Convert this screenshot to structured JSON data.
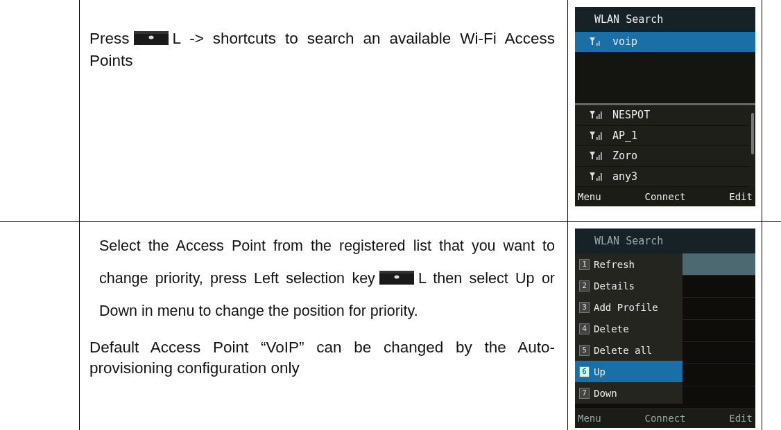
{
  "rows": [
    {
      "kind": "search",
      "text_before": "Press",
      "text_after": "L -> shortcuts to search an available Wi-Fi Access Points",
      "note": "",
      "phone": {
        "title": "WLAN Search",
        "selected_item": {
          "label": "voip",
          "selected": true
        },
        "items": [
          {
            "label": "NESPOT",
            "selected": false
          },
          {
            "label": "AP_1",
            "selected": false
          },
          {
            "label": "Zoro",
            "selected": false
          },
          {
            "label": "any3",
            "selected": false
          }
        ],
        "softkeys": [
          "Menu",
          "Connect",
          "Edit"
        ]
      }
    },
    {
      "kind": "menu",
      "text_before": "Select the Access Point from the registered list that you want to change priority, press Left selection key",
      "text_after": "L then select Up or Down in menu to change the position for priority.",
      "note": "Default Access Point “VoIP” can be changed by the Auto- provisioning configuration only",
      "phone": {
        "title": "WLAN Search",
        "menu": [
          {
            "number": "1",
            "label": "Refresh",
            "selected": false
          },
          {
            "number": "2",
            "label": "Details",
            "selected": false
          },
          {
            "number": "3",
            "label": "Add Profile",
            "selected": false
          },
          {
            "number": "4",
            "label": "Delete",
            "selected": false
          },
          {
            "number": "5",
            "label": "Delete all",
            "selected": false
          },
          {
            "number": "6",
            "label": "Up",
            "selected": true
          },
          {
            "number": "7",
            "label": "Down",
            "selected": false
          }
        ],
        "softkeys": [
          "Menu",
          "Connect",
          "Edit"
        ]
      }
    }
  ]
}
